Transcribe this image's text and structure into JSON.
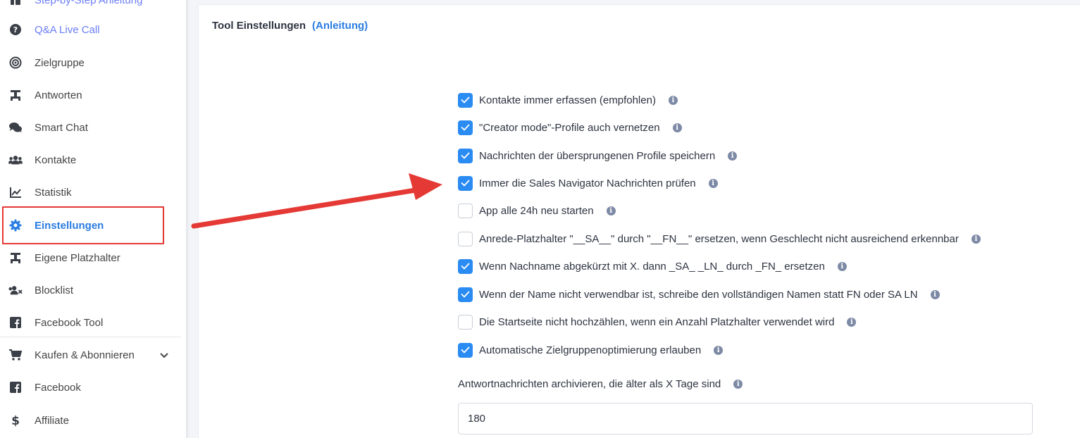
{
  "sidebar": {
    "items": [
      {
        "label": "Step-by-Step Anleitung",
        "icon": "tools-icon"
      },
      {
        "label": "Q&A Live Call",
        "icon": "question-circle-icon"
      },
      {
        "label": "Zielgruppe",
        "icon": "target-icon"
      },
      {
        "label": "Antworten",
        "icon": "reply-icon"
      },
      {
        "label": "Smart Chat",
        "icon": "chat-bubbles-icon"
      },
      {
        "label": "Kontakte",
        "icon": "users-icon"
      },
      {
        "label": "Statistik",
        "icon": "line-chart-icon"
      },
      {
        "label": "Einstellungen",
        "icon": "gear-icon"
      },
      {
        "label": "Eigene Platzhalter",
        "icon": "placeholder-icon"
      },
      {
        "label": "Blocklist",
        "icon": "users-block-icon"
      },
      {
        "label": "Facebook Tool",
        "icon": "facebook-icon"
      },
      {
        "label": "Kaufen & Abonnieren",
        "icon": "cart-icon"
      },
      {
        "label": "Facebook",
        "icon": "facebook-icon"
      },
      {
        "label": "Affiliate",
        "icon": "dollar-icon"
      }
    ]
  },
  "main": {
    "title": "Tool Einstellungen",
    "title_link": "(Anleitung)",
    "options": [
      {
        "label": "Kontakte immer erfassen (empfohlen)",
        "checked": true
      },
      {
        "label": "\"Creator mode\"-Profile auch vernetzen",
        "checked": true
      },
      {
        "label": "Nachrichten der übersprungenen Profile speichern",
        "checked": true
      },
      {
        "label": "Immer die Sales Navigator Nachrichten prüfen",
        "checked": true
      },
      {
        "label": "App alle 24h neu starten",
        "checked": false
      },
      {
        "label": "Anrede-Platzhalter \"__SA__\" durch \"__FN__\" ersetzen, wenn Geschlecht nicht ausreichend erkennbar",
        "checked": false
      },
      {
        "label": "Wenn Nachname abgekürzt mit X. dann _SA_ _LN_ durch _FN_ ersetzen",
        "checked": true
      },
      {
        "label": "Wenn der Name nicht verwendbar ist, schreibe den vollständigen Namen statt FN oder SA LN",
        "checked": true
      },
      {
        "label": "Die Startseite nicht hochzählen, wenn ein Anzahl Platzhalter verwendet wird",
        "checked": false
      },
      {
        "label": "Automatische Zielgruppenoptimierung erlauben",
        "checked": true
      }
    ],
    "archive_label": "Antwortnachrichten archivieren, die älter als X Tage sind",
    "archive_value": "180"
  },
  "colors": {
    "accent": "#2a8bf2",
    "link": "#2a7de1",
    "highlight": "#e53935"
  }
}
